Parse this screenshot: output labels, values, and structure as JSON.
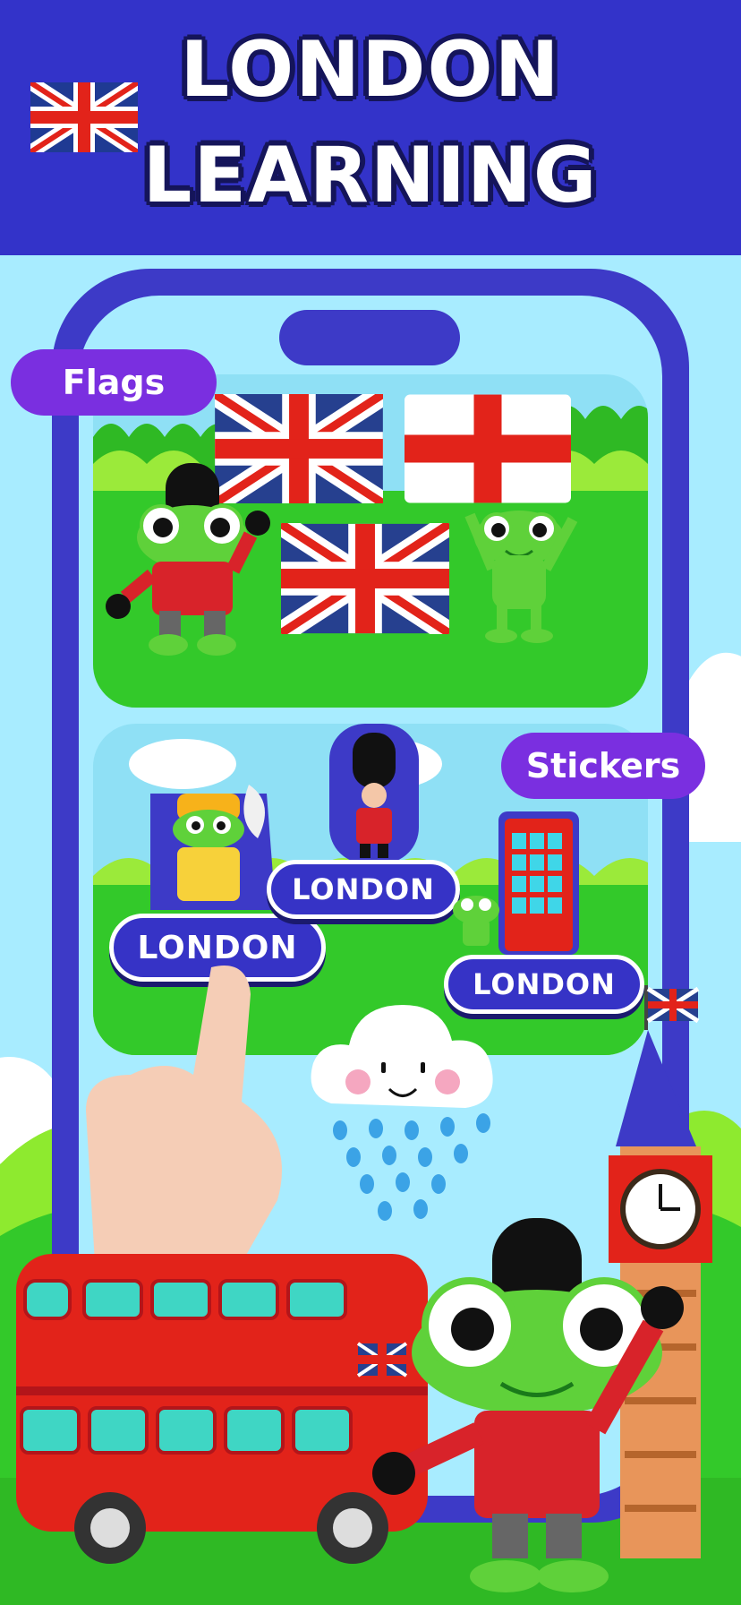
{
  "header": {
    "title_line1": "LONDON",
    "title_line2": "LEARNING"
  },
  "labels": {
    "flags": "Flags",
    "stickers": "Stickers"
  },
  "stickers": [
    {
      "label": "LONDON"
    },
    {
      "label": "LONDON"
    },
    {
      "label": "LONDON"
    }
  ],
  "colors": {
    "header_bg": "#3333c9",
    "phone_frame": "#3d3ac7",
    "pill_purple": "#7a2fe0",
    "grass": "#33c92a",
    "sky": "#a8ecff"
  }
}
